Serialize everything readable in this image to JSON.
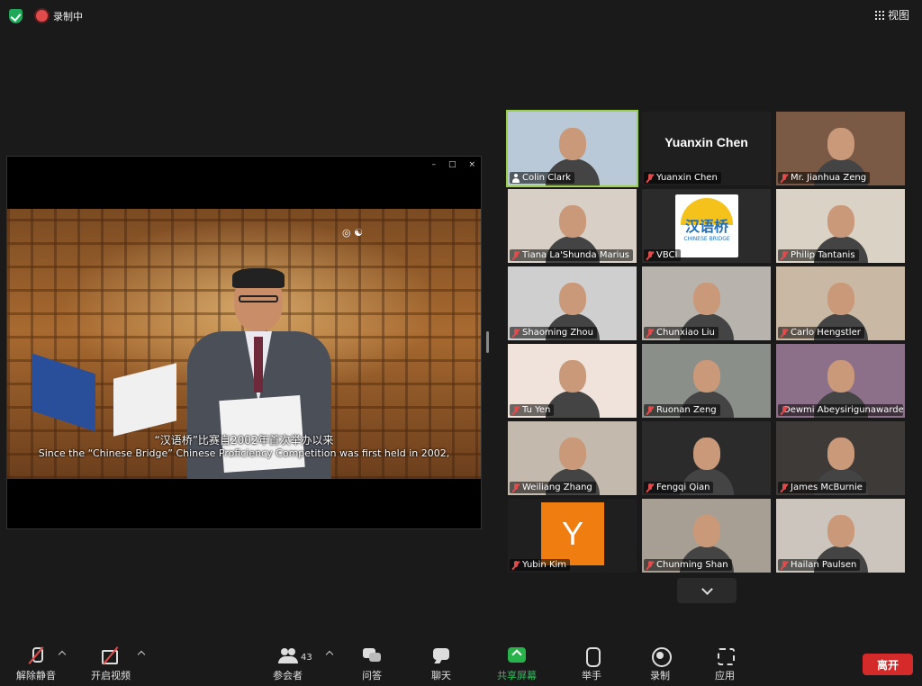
{
  "topbar": {
    "recording_label": "录制中",
    "view_label": "视图"
  },
  "share": {
    "subtitle_zh": "“汉语桥”比赛自2002年首次举办以来",
    "subtitle_en": "Since the “Chinese Bridge” Chinese Proficiency Competition was first held in 2002,",
    "window_controls": [
      "–",
      "□",
      "×"
    ]
  },
  "gallery": {
    "participants": [
      {
        "name": "Colin Clark",
        "muted": false,
        "host": true,
        "active": true,
        "bg": "#b9c9d8"
      },
      {
        "name": "Yuanxin Chen",
        "muted": true,
        "card_text": "Yuanxin Chen",
        "bg": "#1f1f1f"
      },
      {
        "name": "Mr. Jianhua Zeng",
        "muted": true,
        "bg": "#7a5a45"
      },
      {
        "name": "Tiana La'Shunda Marius",
        "muted": true,
        "bg": "#d8d0c6"
      },
      {
        "name": "VBCI",
        "muted": true,
        "logo": "汉语桥",
        "logo_sub": "CHINESE BRIDGE",
        "bg": "#2b2b2b"
      },
      {
        "name": "Philip Tantanis",
        "muted": true,
        "bg": "#d9d2c5"
      },
      {
        "name": "Shaoming Zhou",
        "muted": true,
        "bg": "#cfcfcf"
      },
      {
        "name": "Chunxiao Liu",
        "muted": true,
        "bg": "#b8b3ad"
      },
      {
        "name": "Carlo Hengstler",
        "muted": true,
        "bg": "#c9b9a4"
      },
      {
        "name": "Tu Yen",
        "muted": true,
        "bg": "#efe3dc"
      },
      {
        "name": "Ruonan Zeng",
        "muted": true,
        "bg": "#8a8f8a"
      },
      {
        "name": "Dewmi Abeysirigunawardena",
        "muted": true,
        "bg": "#8c6f88"
      },
      {
        "name": "Weiliang Zhang",
        "muted": true,
        "bg": "#c3b9ad"
      },
      {
        "name": "Fengqi Qian",
        "muted": true,
        "bg": "#2b2b2b"
      },
      {
        "name": "James McBurnie",
        "muted": true,
        "bg": "#3d3a37"
      },
      {
        "name": "Yubin Kim",
        "muted": true,
        "avatar_letter": "Y",
        "bg": "#1f1f1f"
      },
      {
        "name": "Chunming Shan",
        "muted": true,
        "bg": "#a79f94"
      },
      {
        "name": "Hailan Paulsen",
        "muted": true,
        "bg": "#cbc5bd"
      }
    ]
  },
  "toolbar": {
    "unmute_label": "解除静音",
    "start_video_label": "开启视频",
    "participants_label": "参会者",
    "participants_count": "43",
    "qa_label": "问答",
    "chat_label": "聊天",
    "share_label": "共享屏幕",
    "raise_hand_label": "举手",
    "record_label": "录制",
    "apps_label": "应用",
    "leave_label": "离开"
  },
  "colors": {
    "accent_green": "#27b34a",
    "leave_red": "#d42a2a",
    "active_speaker": "#9bd04a",
    "muted_red": "#e24b4b"
  }
}
